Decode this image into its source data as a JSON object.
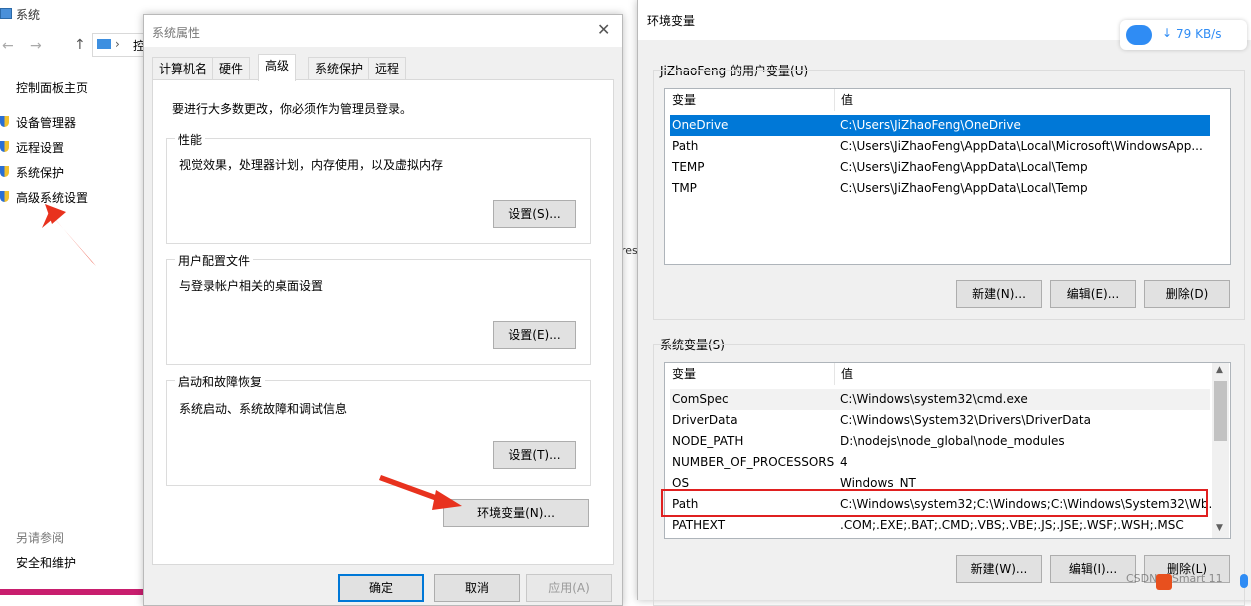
{
  "system_window": {
    "title": "系统",
    "address_char": "控",
    "links": [
      "控制面板主页",
      "设备管理器",
      "远程设置",
      "系统保护",
      "高级系统设置"
    ],
    "see_also": "另请参阅",
    "security": "安全和维护"
  },
  "props": {
    "title": "系统属性",
    "tabs": [
      "计算机名",
      "硬件",
      "高级",
      "系统保护",
      "远程"
    ],
    "admin_note": "要进行大多数更改，你必须作为管理员登录。",
    "performance": {
      "title": "性能",
      "desc": "视觉效果，处理器计划，内存使用，以及虚拟内存",
      "button": "设置(S)..."
    },
    "profiles": {
      "title": "用户配置文件",
      "desc": "与登录帐户相关的桌面设置",
      "button": "设置(E)..."
    },
    "startup": {
      "title": "启动和故障恢复",
      "desc": "系统启动、系统故障和调试信息",
      "button": "设置(T)..."
    },
    "env_button": "环境变量(N)...",
    "ok": "确定",
    "cancel": "取消",
    "apply": "应用(A)"
  },
  "env": {
    "title": "环境变量",
    "user_group": "JiZhaoFeng 的用户变量(U)",
    "sys_group": "系统变量(S)",
    "col_var": "变量",
    "col_val": "值",
    "user_vars": [
      {
        "k": "OneDrive",
        "v": "C:\\Users\\JiZhaoFeng\\OneDrive"
      },
      {
        "k": "Path",
        "v": "C:\\Users\\JiZhaoFeng\\AppData\\Local\\Microsoft\\WindowsApp..."
      },
      {
        "k": "TEMP",
        "v": "C:\\Users\\JiZhaoFeng\\AppData\\Local\\Temp"
      },
      {
        "k": "TMP",
        "v": "C:\\Users\\JiZhaoFeng\\AppData\\Local\\Temp"
      }
    ],
    "sys_vars": [
      {
        "k": "ComSpec",
        "v": "C:\\Windows\\system32\\cmd.exe"
      },
      {
        "k": "DriverData",
        "v": "C:\\Windows\\System32\\Drivers\\DriverData"
      },
      {
        "k": "NODE_PATH",
        "v": "D:\\nodejs\\node_global\\node_modules"
      },
      {
        "k": "NUMBER_OF_PROCESSORS",
        "v": "4"
      },
      {
        "k": "OS",
        "v": "Windows_NT"
      },
      {
        "k": "Path",
        "v": "C:\\Windows\\system32;C:\\Windows;C:\\Windows\\System32\\Wb..."
      },
      {
        "k": "PATHEXT",
        "v": ".COM;.EXE;.BAT;.CMD;.VBS;.VBE;.JS;.JSE;.WSF;.WSH;.MSC"
      }
    ],
    "user_buttons": [
      "新建(N)...",
      "编辑(E)...",
      "删除(D)"
    ],
    "sys_buttons": [
      "新建(W)...",
      "编辑(I)...",
      "删除(L)"
    ]
  },
  "speed_widget": {
    "speed": "79 KB/s"
  },
  "watermark": "CSDN @Smart  11",
  "behind_text": "res",
  "colors": {
    "selection": "#0078d7",
    "highlight_box": "#e02020",
    "arrow": "#e8321e"
  }
}
